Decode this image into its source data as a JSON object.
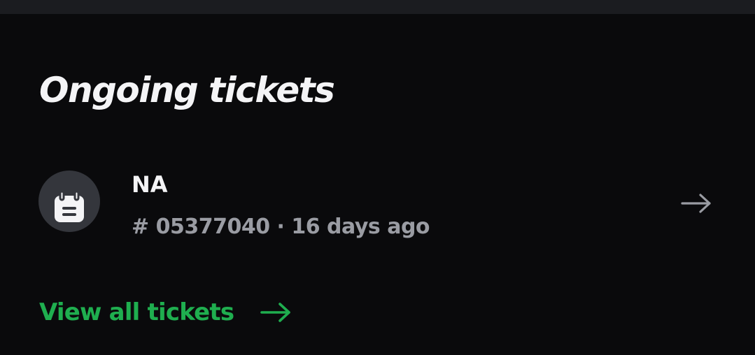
{
  "section": {
    "title": "Ongoing tickets"
  },
  "tickets": [
    {
      "title": "NA",
      "meta": "# 05377040 · 16 days ago",
      "icon": "calendar-note-icon"
    }
  ],
  "view_all": {
    "label": "View all tickets",
    "icon": "arrow-right-icon"
  },
  "colors": {
    "background": "#0a0a0c",
    "accent": "#1fae4f",
    "text_primary": "#f4f4f6",
    "text_secondary": "#9a9ca3",
    "avatar_bg": "#34363c"
  }
}
